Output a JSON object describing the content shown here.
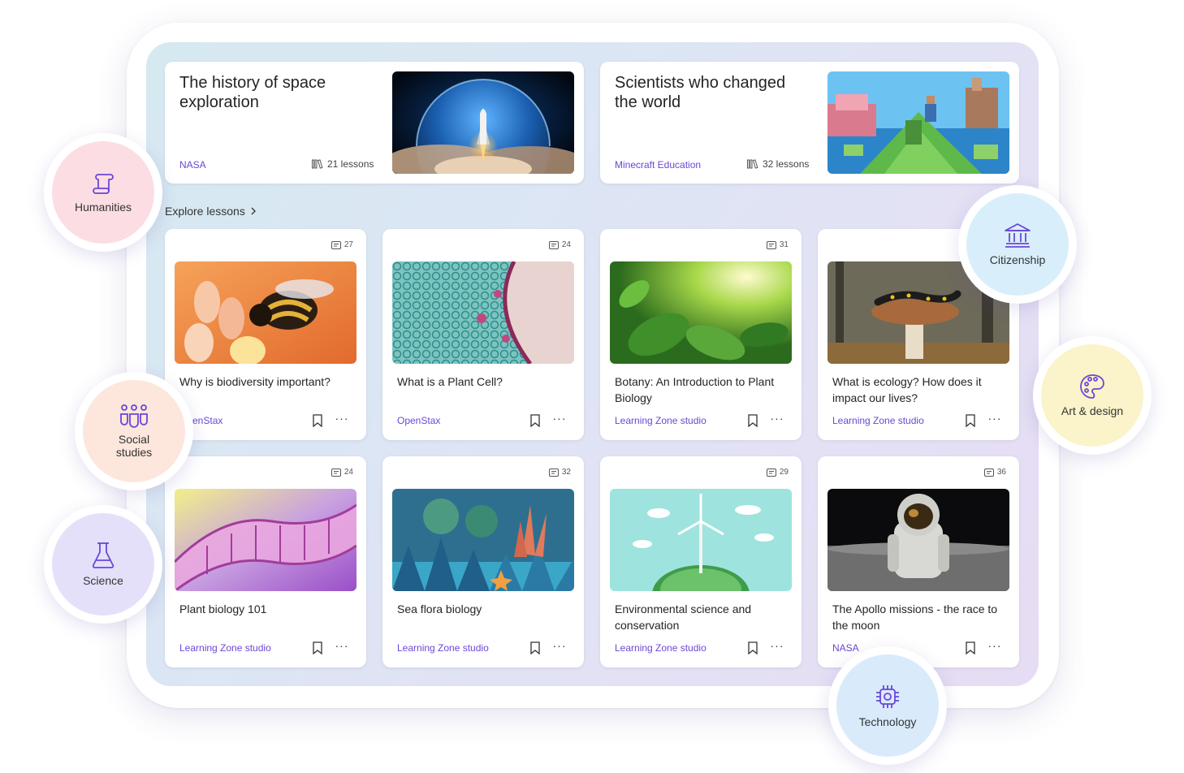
{
  "featured": [
    {
      "title": "The history of space exploration",
      "source": "NASA",
      "lessons": "21 lessons"
    },
    {
      "title": "Scientists who changed the world",
      "source": "Minecraft Education",
      "lessons": "32 lessons"
    }
  ],
  "explore_label": "Explore lessons",
  "lessons": [
    {
      "count": "27",
      "title": "Why is biodiversity important?",
      "source": "OpenStax"
    },
    {
      "count": "24",
      "title": "What is a Plant Cell?",
      "source": "OpenStax"
    },
    {
      "count": "31",
      "title": "Botany: An Introduction to Plant Biology",
      "source": "Learning Zone studio"
    },
    {
      "count": "",
      "title": "What is ecology? How does it impact our lives?",
      "source": "Learning Zone studio"
    },
    {
      "count": "24",
      "title": "Plant biology 101",
      "source": "Learning Zone studio"
    },
    {
      "count": "32",
      "title": "Sea flora biology",
      "source": "Learning Zone studio"
    },
    {
      "count": "29",
      "title": "Environmental science and conservation",
      "source": "Learning Zone studio"
    },
    {
      "count": "36",
      "title": "The Apollo missions - the race to the moon",
      "source": "NASA"
    }
  ],
  "subjects": {
    "humanities": "Humanities",
    "social": "Social\nstudies",
    "science": "Science",
    "citizenship": "Citizenship",
    "art": "Art & design",
    "technology": "Technology"
  },
  "colors": {
    "accent": "#6b47d6",
    "humanities_bg": "#fbdde3",
    "social_bg": "#fde6dc",
    "science_bg": "#e5e0fa",
    "citizenship_bg": "#d9eefb",
    "art_bg": "#fbf3c9",
    "technology_bg": "#d9eafb"
  },
  "icons": {
    "humanities": "scroll-icon",
    "social": "people-group-icon",
    "science": "beaker-icon",
    "citizenship": "institution-icon",
    "art": "palette-icon",
    "technology": "chip-icon",
    "lesson_count": "slides-icon",
    "lessons": "library-icon",
    "bookmark": "bookmark-icon",
    "more": "more-icon",
    "chevron": "chevron-right-icon"
  }
}
